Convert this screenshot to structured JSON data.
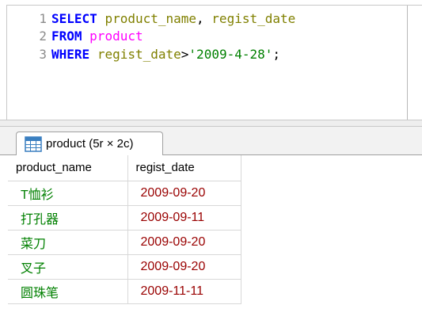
{
  "editor": {
    "lines": [
      {
        "num": "1",
        "tokens": [
          {
            "text": "SELECT",
            "kind": "kw"
          },
          {
            "text": " ",
            "kind": "op"
          },
          {
            "text": "product_name",
            "kind": "ident"
          },
          {
            "text": ", ",
            "kind": "op"
          },
          {
            "text": "regist_date",
            "kind": "ident"
          }
        ]
      },
      {
        "num": "2",
        "tokens": [
          {
            "text": "FROM",
            "kind": "kw"
          },
          {
            "text": " ",
            "kind": "op"
          },
          {
            "text": "product",
            "kind": "tbl"
          }
        ]
      },
      {
        "num": "3",
        "tokens": [
          {
            "text": "WHERE",
            "kind": "kw"
          },
          {
            "text": " ",
            "kind": "op"
          },
          {
            "text": "regist_date",
            "kind": "ident"
          },
          {
            "text": ">",
            "kind": "op"
          },
          {
            "text": "'2009-4-28'",
            "kind": "str"
          },
          {
            "text": ";",
            "kind": "op"
          }
        ]
      }
    ],
    "colors": {
      "keyword": "#0000ff",
      "identifier": "#808000",
      "table": "#ff00ff",
      "string": "#008000",
      "gutter": "#8c8c8c"
    }
  },
  "result_tab": {
    "icon": "table-grid-icon",
    "label": "product (5r × 2c)"
  },
  "grid": {
    "columns": [
      "product_name",
      "regist_date"
    ],
    "rows": [
      [
        "T恤衫",
        "2009-09-20"
      ],
      [
        "打孔器",
        "2009-09-11"
      ],
      [
        "菜刀",
        "2009-09-20"
      ],
      [
        "叉子",
        "2009-09-20"
      ],
      [
        "圆珠笔",
        "2009-11-11"
      ]
    ],
    "colors": {
      "text_value": "#008000",
      "date_value": "#990000"
    }
  }
}
